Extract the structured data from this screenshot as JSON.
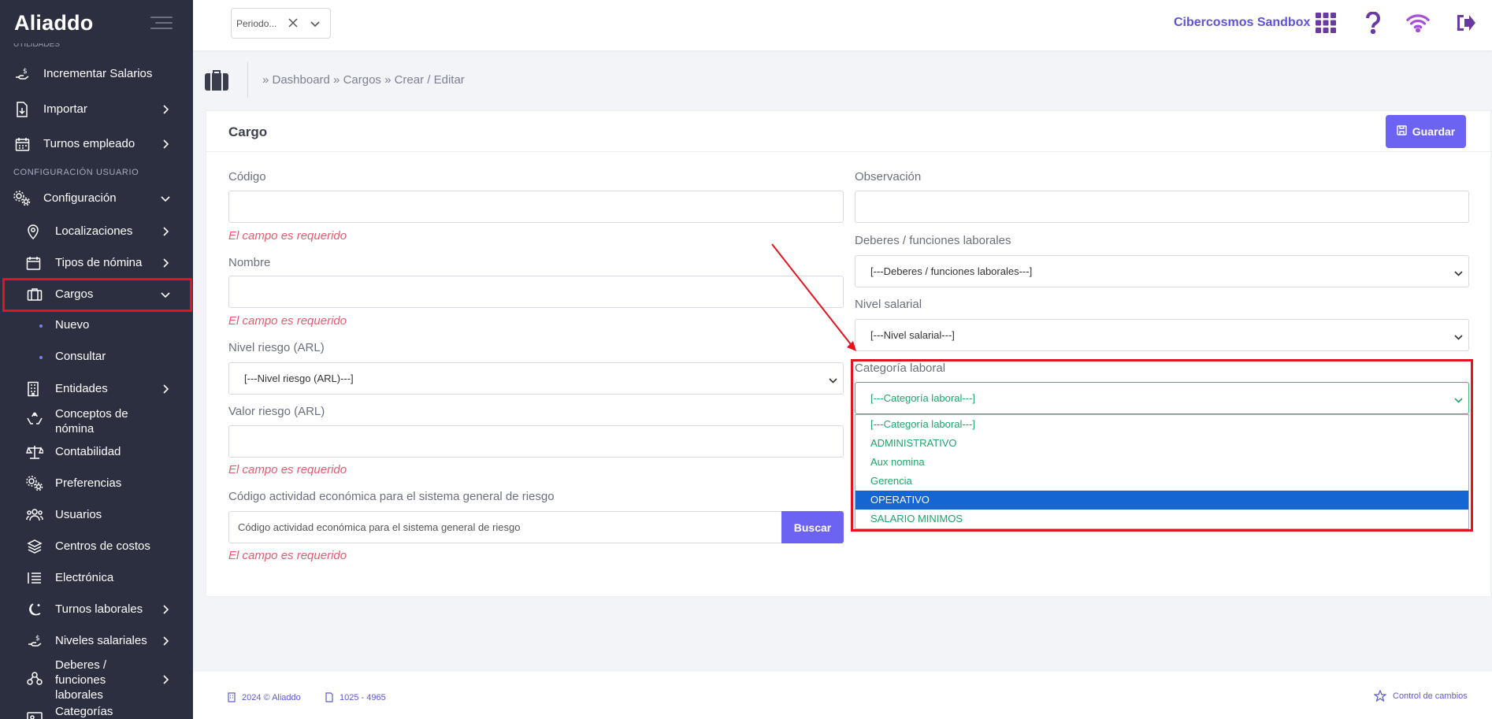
{
  "app": {
    "logo": "Aliaddo"
  },
  "sidebar": {
    "cut_section": "UTILIDADES",
    "section_config": "CONFIGURACIÓN USUARIO",
    "items": [
      {
        "label": "Incrementar Salarios",
        "icon": "hand-money-icon"
      },
      {
        "label": "Importar",
        "icon": "file-import-icon"
      },
      {
        "label": "Turnos empleado",
        "icon": "calendar-icon"
      },
      {
        "label": "Configuración",
        "icon": "gears-icon"
      },
      {
        "label": "Localizaciones",
        "icon": "location-pin-icon"
      },
      {
        "label": "Tipos de nómina",
        "icon": "calendar-icon"
      },
      {
        "label": "Cargos",
        "icon": "briefcase-icon"
      },
      {
        "label": "Nuevo"
      },
      {
        "label": "Consultar"
      },
      {
        "label": "Entidades",
        "icon": "building-icon"
      },
      {
        "label": "Conceptos de",
        "label2": "nómina",
        "icon": "hands-icon"
      },
      {
        "label": "Contabilidad",
        "icon": "scale-icon"
      },
      {
        "label": "Preferencias",
        "icon": "gears-icon"
      },
      {
        "label": "Usuarios",
        "icon": "users-icon"
      },
      {
        "label": "Centros de costos",
        "icon": "layers-icon"
      },
      {
        "label": "Electrónica",
        "icon": "list-icon"
      },
      {
        "label": "Turnos laborales",
        "icon": "moon-icon"
      },
      {
        "label": "Niveles salariales",
        "icon": "hand-money-icon"
      },
      {
        "label": "Deberes /",
        "label2": "funciones",
        "label3": "laborales",
        "icon": "org-icon"
      },
      {
        "label": "Categorías",
        "icon": "id-card-icon"
      }
    ]
  },
  "topbar": {
    "period_placeholder": "Periodo...",
    "company": "Cibercosmos Sandbox",
    "icons": [
      "apps-grid-icon",
      "help-icon",
      "wifi-icon",
      "logout-icon"
    ]
  },
  "breadcrumb": "» Dashboard » Cargos » Crear / Editar",
  "card": {
    "title": "Cargo",
    "save_label": "Guardar"
  },
  "form": {
    "codigo_label": "Código",
    "nombre_label": "Nombre",
    "nivel_riesgo_label": "Nivel riesgo (ARL)",
    "nivel_riesgo_value": "[---Nivel riesgo (ARL)---]",
    "valor_riesgo_label": "Valor riesgo (ARL)",
    "codigo_actividad_label": "Código actividad económica para el sistema general de riesgo",
    "codigo_actividad_placeholder": "Código actividad económica para el sistema general de riesgo",
    "buscar_label": "Buscar",
    "required_error": "El campo es requerido",
    "observacion_label": "Observación",
    "deberes_label": "Deberes / funciones laborales",
    "deberes_value": "[---Deberes / funciones laborales---]",
    "nivel_salarial_label": "Nivel salarial",
    "nivel_salarial_value": "[---Nivel salarial---]",
    "categoria_label": "Categoría laboral",
    "categoria_value": "[---Categoría laboral---]",
    "categoria_options": [
      "[---Categoría laboral---]",
      "ADMINISTRATIVO",
      "Aux nomina",
      "Gerencia",
      "OPERATIVO",
      "SALARIO MINIMOS"
    ],
    "categoria_highlighted": "OPERATIVO"
  },
  "footer": {
    "copyright": "2024 © Aliaddo",
    "version": "1025 - 4965",
    "changes": "Control de cambios"
  },
  "colors": {
    "sidebar_bg": "#2b2f3f",
    "accent": "#6c63f2",
    "error": "#e85a70",
    "option_green": "#1ea569",
    "option_selected": "#1565d2",
    "highlight_red": "#e3141d"
  }
}
